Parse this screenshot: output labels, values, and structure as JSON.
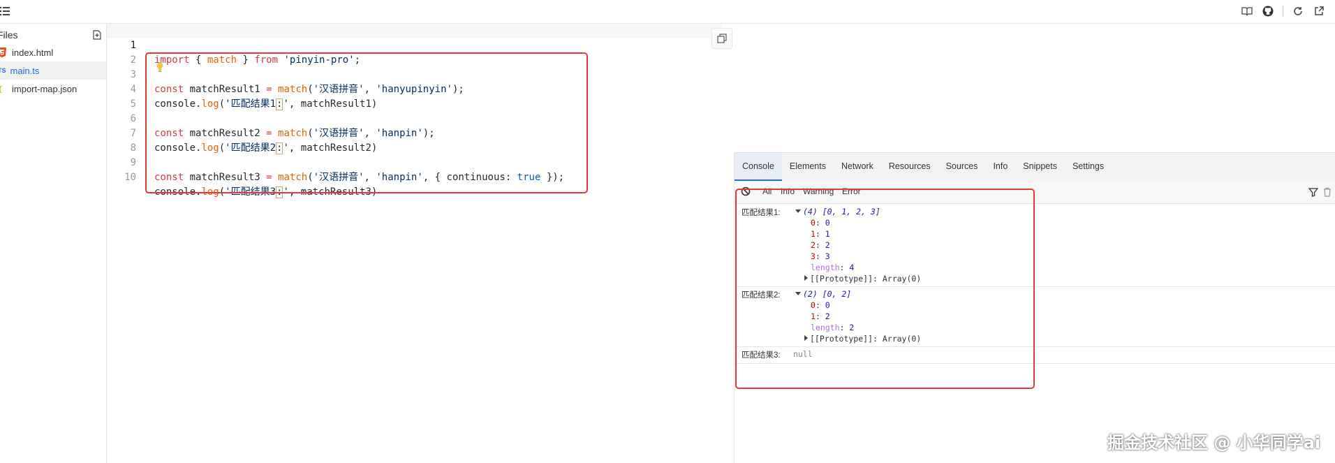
{
  "explorer": {
    "title": "Files",
    "files": [
      {
        "name": "index.html",
        "icon": "html5-icon",
        "active": false
      },
      {
        "name": "main.ts",
        "icon": "typescript-icon",
        "active": true,
        "badge": "TS"
      },
      {
        "name": "import-map.json",
        "icon": "json-icon",
        "active": false
      }
    ]
  },
  "editor": {
    "line_numbers": [
      "1",
      "2",
      "3",
      "4",
      "5",
      "6",
      "7",
      "8",
      "9",
      "10"
    ],
    "lines": {
      "l1": {
        "kw1": "import",
        "p1": " { ",
        "fn": "match",
        "p2": " } ",
        "kw2": "from",
        "p3": " ",
        "str": "'pinyin-pro'",
        "p4": ";"
      },
      "l3": {
        "kw": "const",
        "p1": " matchResult1 ",
        "op": "=",
        "p2": " ",
        "fn": "match",
        "p3": "(",
        "s1": "'汉语拼音'",
        "p4": ", ",
        "s2": "'hanyupinyin'",
        "p5": ");"
      },
      "l4": {
        "p1": "console.",
        "fn": "log",
        "p2": "(",
        "s1a": "'匹配结果1",
        "s1b": ":",
        "s1c": "'",
        "p3": ", matchResult1)"
      },
      "l6": {
        "kw": "const",
        "p1": " matchResult2 ",
        "op": "=",
        "p2": " ",
        "fn": "match",
        "p3": "(",
        "s1": "'汉语拼音'",
        "p4": ", ",
        "s2": "'hanpin'",
        "p5": ");"
      },
      "l7": {
        "p1": "console.",
        "fn": "log",
        "p2": "(",
        "s1a": "'匹配结果2",
        "s1b": ":",
        "s1c": "'",
        "p3": ", matchResult2)"
      },
      "l9": {
        "kw": "const",
        "p1": " matchResult3 ",
        "op": "=",
        "p2": " ",
        "fn": "match",
        "p3": "(",
        "s1": "'汉语拼音'",
        "p4": ", ",
        "s2": "'hanpin'",
        "p5": ", { ",
        "prop": "continuous",
        "p6": ": ",
        "bool": "true",
        "p7": " });"
      },
      "l10": {
        "p1": "console.",
        "fn": "log",
        "p2": "(",
        "s1a": "'匹配结果3",
        "s1b": ":",
        "s1c": "'",
        "p3": ", matchResult3)"
      }
    }
  },
  "devtools": {
    "tabs": [
      "Console",
      "Elements",
      "Network",
      "Resources",
      "Sources",
      "Info",
      "Snippets",
      "Settings"
    ],
    "active_tab": "Console",
    "filters": [
      "All",
      "Info",
      "Warning",
      "Error"
    ],
    "logs": [
      {
        "label": "匹配结果1:",
        "summary": "(4) [0, 1, 2, 3]",
        "entries": [
          {
            "k": "0",
            "v": "0"
          },
          {
            "k": "1",
            "v": "1"
          },
          {
            "k": "2",
            "v": "2"
          },
          {
            "k": "3",
            "v": "3"
          }
        ],
        "length_key": "length",
        "length": "4",
        "prototype": "[[Prototype]]: Array(0)"
      },
      {
        "label": "匹配结果2:",
        "summary": "(2) [0, 2]",
        "entries": [
          {
            "k": "0",
            "v": "0"
          },
          {
            "k": "1",
            "v": "2"
          }
        ],
        "length_key": "length",
        "length": "2",
        "prototype": "[[Prototype]]: Array(0)"
      },
      {
        "label": "匹配结果3:",
        "value": "null"
      }
    ]
  },
  "watermark": "掘金技术社区 @ 小华同学ai"
}
